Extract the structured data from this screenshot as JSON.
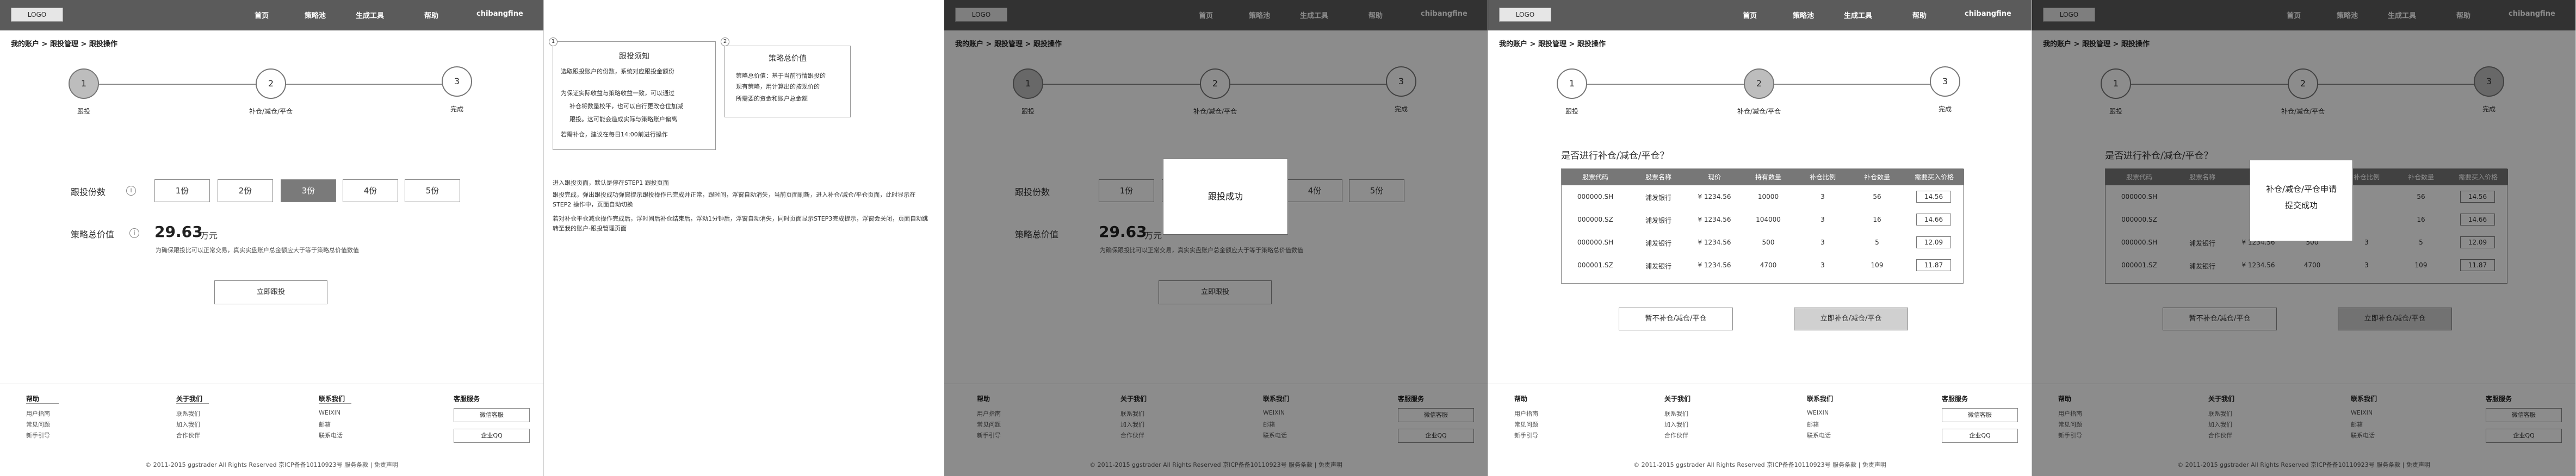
{
  "nav": {
    "logo": "LOGO",
    "items": [
      "首页",
      "策略池",
      "生成工具",
      "帮助"
    ],
    "user": "chibangfine"
  },
  "breadcrumb": "我的账户 > 跟投管理 > 跟投操作",
  "steps": {
    "s1": {
      "num": "1",
      "label": "跟投"
    },
    "s2": {
      "num": "2",
      "label": "补仓/减仓/平仓"
    },
    "s3": {
      "num": "3",
      "label": "完成"
    }
  },
  "form": {
    "label_shares": "跟投份数",
    "options": [
      "1份",
      "2份",
      "3份",
      "4份",
      "5份"
    ],
    "selected": "3份",
    "label_total": "策略总价值",
    "total_value": "29.63",
    "unit": "万元",
    "hint": "为确保跟投比可以正常交易，真实实盘账户总金额应大于等于策略总价值数值",
    "submit": "立即跟投"
  },
  "notes": {
    "n1": {
      "num": "1",
      "title": "跟投须知",
      "lines": [
        "选取跟投账户的份数，系统对应跟投金额份",
        "为保证实际收益与策略收益一致，可以通过",
        "补仓将数量校平，也可以自行更改仓位加减",
        "跟投。这可能会造成实际与策略账户偏离",
        "若需补仓，建议在每日14:00前进行操作"
      ]
    },
    "n2": {
      "num": "2",
      "title": "策略总价值",
      "lines": [
        "策略总价值：基于当前行情跟投的",
        "现有策略，用计算出的按现价的",
        "所需要的资金和账户总金额"
      ]
    },
    "desc1": "进入跟投页面，默认是停在STEP1 跟投页面",
    "desc2": "跟投完成，弹出跟投成功弹窗提示跟投操作已完成并正常，跟时间，浮窗自动消失，当前页面刷新，进入补仓/减仓/平仓页面，此时显示在STEP2 操作中，页面自动切换",
    "desc3": "若对补仓平仓减仓操作完成后，浮时间后补仓结束后，浮动1分钟后，浮窗自动消失，同时页面显示STEP3完成提示，浮窗会关闭，页面自动跳转至我的账户-跟投管理页面"
  },
  "modal1": "跟投成功",
  "rebalance": {
    "question": "是否进行补仓/减仓/平仓？",
    "headers": [
      "股票代码",
      "股票名称",
      "现价",
      "持有数量",
      "补仓比例",
      "补仓数量",
      "需要买入价格"
    ],
    "rows": [
      [
        "000000.SH",
        "浦发银行",
        "¥ 1234.56",
        "10000",
        "3",
        "56",
        "14.56"
      ],
      [
        "000000.SZ",
        "浦发银行",
        "¥ 1234.56",
        "104000",
        "3",
        "16",
        "14.66"
      ],
      [
        "000000.SH",
        "浦发银行",
        "¥ 1234.56",
        "500",
        "3",
        "5",
        "12.09"
      ],
      [
        "000001.SZ",
        "浦发银行",
        "¥ 1234.56",
        "4700",
        "3",
        "109",
        "11.87"
      ]
    ],
    "skip": "暂不补仓/减仓/平仓",
    "confirm": "立即补仓/减仓/平仓"
  },
  "modal2": {
    "line1": "补仓/减仓/平仓申请",
    "line2": "提交成功"
  },
  "footer": {
    "cols": [
      {
        "title": "帮助",
        "items": [
          "用户指南",
          "常见问题",
          "新手引导"
        ]
      },
      {
        "title": "关于我们",
        "items": [
          "联系我们",
          "加入我们",
          "合作伙伴"
        ]
      },
      {
        "title": "联系我们",
        "items": [
          "WEIXIN",
          "邮箱",
          "联系电话"
        ]
      },
      {
        "title": "客服服务",
        "items": [
          "微信客服",
          "企业QQ"
        ]
      }
    ],
    "copyright": "© 2011-2015 ggstrader  All Rights Reserved    京ICP备备10110923号 服务条款 | 免责声明"
  }
}
